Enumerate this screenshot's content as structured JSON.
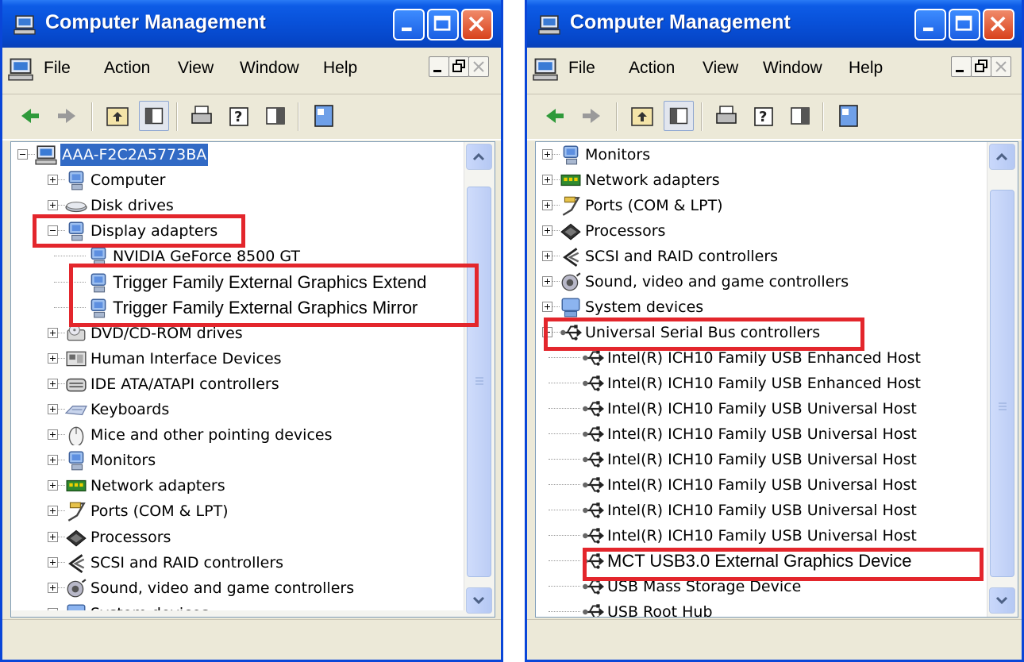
{
  "colors": {
    "titlebar": "#0850d8",
    "highlight": "#e3262c",
    "selection": "#316ac5"
  },
  "left": {
    "title": "Computer Management",
    "menu": [
      "File",
      "Action",
      "View",
      "Window",
      "Help"
    ],
    "tree": [
      {
        "label": "AAA-F2C2A5773BA",
        "icon": "computer-icon",
        "selected": true
      },
      {
        "label": "Computer",
        "icon": "computer-device-icon"
      },
      {
        "label": "Disk drives",
        "icon": "disk-drive-icon"
      },
      {
        "label": "Display adapters",
        "icon": "display-adapter-icon"
      },
      {
        "label": "NVIDIA GeForce 8500 GT",
        "icon": "display-adapter-icon"
      },
      {
        "label": "Trigger Family External Graphics Extend",
        "icon": "display-adapter-icon"
      },
      {
        "label": "Trigger Family External Graphics Mirror",
        "icon": "display-adapter-icon"
      },
      {
        "label": "DVD/CD-ROM drives",
        "icon": "dvd-drive-icon"
      },
      {
        "label": "Human Interface Devices",
        "icon": "hid-icon"
      },
      {
        "label": "IDE ATA/ATAPI controllers",
        "icon": "ide-controller-icon"
      },
      {
        "label": "Keyboards",
        "icon": "keyboard-icon"
      },
      {
        "label": "Mice and other pointing devices",
        "icon": "mouse-icon"
      },
      {
        "label": "Monitors",
        "icon": "monitor-icon"
      },
      {
        "label": "Network adapters",
        "icon": "network-adapter-icon"
      },
      {
        "label": "Ports (COM & LPT)",
        "icon": "port-icon"
      },
      {
        "label": "Processors",
        "icon": "processor-icon"
      },
      {
        "label": "SCSI and RAID controllers",
        "icon": "scsi-icon"
      },
      {
        "label": "Sound, video and game controllers",
        "icon": "sound-icon"
      },
      {
        "label": "System devices",
        "icon": "system-devices-icon"
      }
    ]
  },
  "right": {
    "title": "Computer Management",
    "menu": [
      "File",
      "Action",
      "View",
      "Window",
      "Help"
    ],
    "tree": [
      {
        "label": "Monitors",
        "icon": "monitor-icon"
      },
      {
        "label": "Network adapters",
        "icon": "network-adapter-icon"
      },
      {
        "label": "Ports (COM & LPT)",
        "icon": "port-icon"
      },
      {
        "label": "Processors",
        "icon": "processor-icon"
      },
      {
        "label": "SCSI and RAID controllers",
        "icon": "scsi-icon"
      },
      {
        "label": "Sound, video and game controllers",
        "icon": "sound-icon"
      },
      {
        "label": "System devices",
        "icon": "system-devices-icon"
      },
      {
        "label": "Universal Serial Bus controllers",
        "icon": "usb-icon"
      },
      {
        "label": "Intel(R) ICH10 Family USB Enhanced Host",
        "icon": "usb-icon"
      },
      {
        "label": "Intel(R) ICH10 Family USB Enhanced Host",
        "icon": "usb-icon"
      },
      {
        "label": "Intel(R) ICH10 Family USB Universal Host",
        "icon": "usb-icon"
      },
      {
        "label": "Intel(R) ICH10 Family USB Universal Host",
        "icon": "usb-icon"
      },
      {
        "label": "Intel(R) ICH10 Family USB Universal Host",
        "icon": "usb-icon"
      },
      {
        "label": "Intel(R) ICH10 Family USB Universal Host",
        "icon": "usb-icon"
      },
      {
        "label": "Intel(R) ICH10 Family USB Universal Host",
        "icon": "usb-icon"
      },
      {
        "label": "Intel(R) ICH10 Family USB Universal Host",
        "icon": "usb-icon"
      },
      {
        "label": "MCT USB3.0 External Graphics Device",
        "icon": "usb-icon"
      },
      {
        "label": "USB Mass Storage Device",
        "icon": "usb-icon"
      },
      {
        "label": "USB Root Hub",
        "icon": "usb-icon"
      }
    ]
  }
}
